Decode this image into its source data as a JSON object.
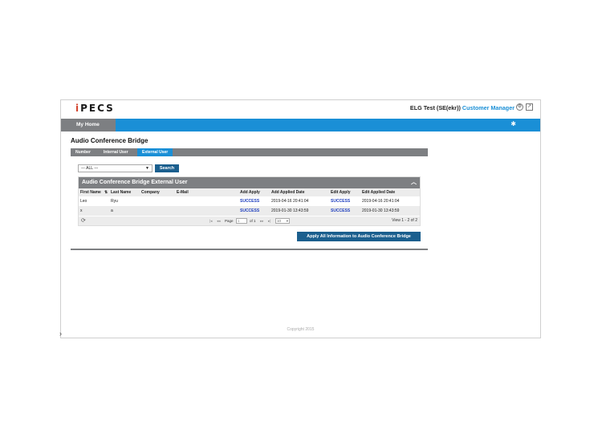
{
  "header": {
    "logo": "iPECS",
    "site_name": "ELG Test (SE(ekr))",
    "user_role": "Customer Manager",
    "icons": [
      "settings-icon",
      "logout-icon"
    ]
  },
  "nav": {
    "my_home": "My Home",
    "star_icon": "star-icon"
  },
  "page": {
    "title": "Audio Conference Bridge",
    "tabs": [
      {
        "label": "Number",
        "active": false
      },
      {
        "label": "Internal User",
        "active": false
      },
      {
        "label": "External User",
        "active": true
      }
    ]
  },
  "filter": {
    "selected": "--- ALL ---",
    "search_label": "Search"
  },
  "panel": {
    "title": "Audio Conference Bridge External User",
    "columns": [
      "First Name",
      "Last Name",
      "Company",
      "E-Mail",
      "Add Apply",
      "Add Applied Date",
      "Edit Apply",
      "Edit Applied Date"
    ],
    "rows": [
      {
        "first": "Leo",
        "last": "Ryu",
        "company": "",
        "email": "",
        "add_apply": "SUCCESS",
        "add_date": "2019-04-16 20:41:04",
        "edit_apply": "SUCCESS",
        "edit_date": "2019-04-16 20:41:04"
      },
      {
        "first": "x",
        "last": "a",
        "company": "",
        "email": "",
        "add_apply": "SUCCESS",
        "add_date": "2019-01-30 13:43:59",
        "edit_apply": "SUCCESS",
        "edit_date": "2019-01-30 13:43:59"
      }
    ],
    "pager": {
      "page_label": "Page",
      "page_value": "1",
      "of_label": "of 1",
      "page_size": "10",
      "view_info": "View 1 - 2 of 2"
    }
  },
  "apply_all_label": "Apply All Information to Audio Conference Bridge",
  "footer": {
    "copyright": "Copyright 2015"
  },
  "colors": {
    "accent_blue": "#1a8fd6",
    "nav_gray": "#7d7f82",
    "button_dark": "#1b5f8e",
    "success": "#1f3fbf"
  }
}
